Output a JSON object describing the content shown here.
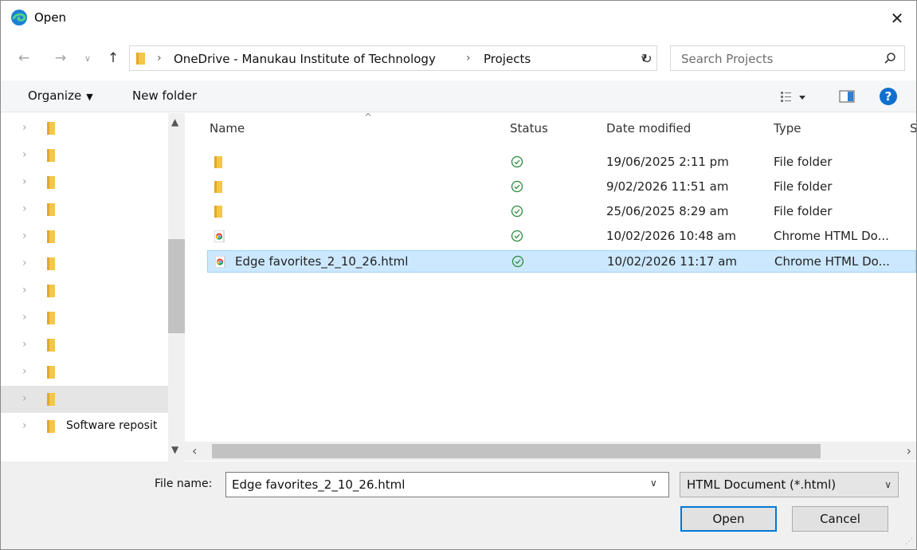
{
  "window": {
    "title": "Open",
    "close_glyph": "✕"
  },
  "nav": {
    "back_glyph": "←",
    "forward_glyph": "→",
    "recent_glyph": "∨",
    "up_glyph": "↑",
    "path": [
      "OneDrive - Manukau Institute of Technology",
      "Projects"
    ],
    "separator": "›",
    "dropdown_glyph": "∨",
    "refresh_glyph": "↻"
  },
  "search": {
    "placeholder": "Search Projects"
  },
  "toolbar": {
    "organize_label": "Organize",
    "organize_caret": "▼",
    "new_folder_label": "New folder",
    "view_caret": "▼",
    "help_label": "?"
  },
  "nav_pane": {
    "items": [
      {
        "label": "",
        "selected": false
      },
      {
        "label": "",
        "selected": false
      },
      {
        "label": "",
        "selected": false
      },
      {
        "label": "",
        "selected": false
      },
      {
        "label": "",
        "selected": false
      },
      {
        "label": "",
        "selected": false
      },
      {
        "label": "",
        "selected": false
      },
      {
        "label": "",
        "selected": false
      },
      {
        "label": "",
        "selected": false
      },
      {
        "label": "",
        "selected": false
      },
      {
        "label": "",
        "selected": true
      },
      {
        "label": "Software reposit",
        "selected": false
      }
    ],
    "chevron_glyph": "›"
  },
  "columns": {
    "name": "Name",
    "status": "Status",
    "date": "Date modified",
    "type": "Type",
    "size": "S"
  },
  "files": [
    {
      "name": "",
      "icon": "folder-icon",
      "date": "19/06/2025 2:11 pm",
      "type": "File folder",
      "selected": false
    },
    {
      "name": "",
      "icon": "folder-icon",
      "date": "9/02/2026 11:51 am",
      "type": "File folder",
      "selected": false
    },
    {
      "name": "",
      "icon": "folder-icon",
      "date": "25/06/2025 8:29 am",
      "type": "File folder",
      "selected": false
    },
    {
      "name": "",
      "icon": "chrome-html-icon",
      "date": "10/02/2026 10:48 am",
      "type": "Chrome HTML Do...",
      "selected": false
    },
    {
      "name": "Edge favorites_2_10_26.html",
      "icon": "chrome-html-icon",
      "date": "10/02/2026 11:17 am",
      "type": "Chrome HTML Do...",
      "selected": true
    }
  ],
  "bottom": {
    "file_name_label": "File name:",
    "file_name_value": "Edge favorites_2_10_26.html",
    "file_type": "HTML Document (*.html)",
    "open_label": "Open",
    "cancel_label": "Cancel"
  },
  "colors": {
    "accent": "#0078d7",
    "selection": "#cce8ff",
    "folder": "#f4c64a",
    "status_ok": "#2b8a3e"
  }
}
